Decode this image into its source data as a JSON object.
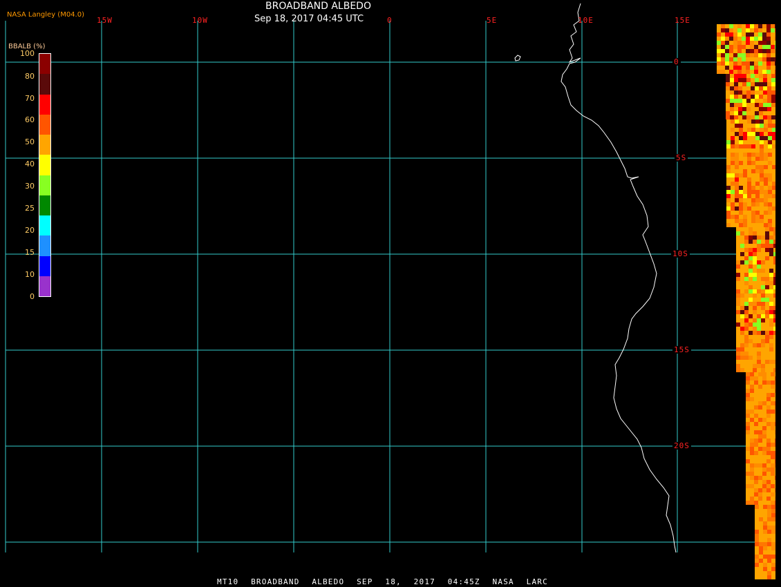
{
  "header": {
    "credit": "NASA Langley (M04.0)",
    "title": "BROADBAND ALBEDO",
    "subtitle": "Sep 18, 2017 04:45 UTC"
  },
  "scale": {
    "title": "BBALB (%)",
    "ticks": [
      "100",
      "80",
      "70",
      "60",
      "50",
      "40",
      "30",
      "25",
      "20",
      "15",
      "10",
      "0"
    ],
    "colors": [
      "#8b0000",
      "#5a0a0a",
      "#ff0000",
      "#ff5500",
      "#ffa500",
      "#ffff00",
      "#88ff22",
      "#008800",
      "#00ffff",
      "#1e90ff",
      "#0000ff",
      "#9932cc"
    ]
  },
  "lon_labels": [
    "15W",
    "10W",
    "0",
    "5E",
    "10E",
    "15E"
  ],
  "lat_labels": [
    "0",
    "5S",
    "10S",
    "15S",
    "20S"
  ],
  "footer": "MT10 BROADBAND ALBEDO SEP 18, 2017 04:45Z NASA LARC",
  "colors": {
    "grid": "#33cccc",
    "coastline": "#ffffff",
    "label": "#ff2222",
    "credit": "#ff9900"
  }
}
